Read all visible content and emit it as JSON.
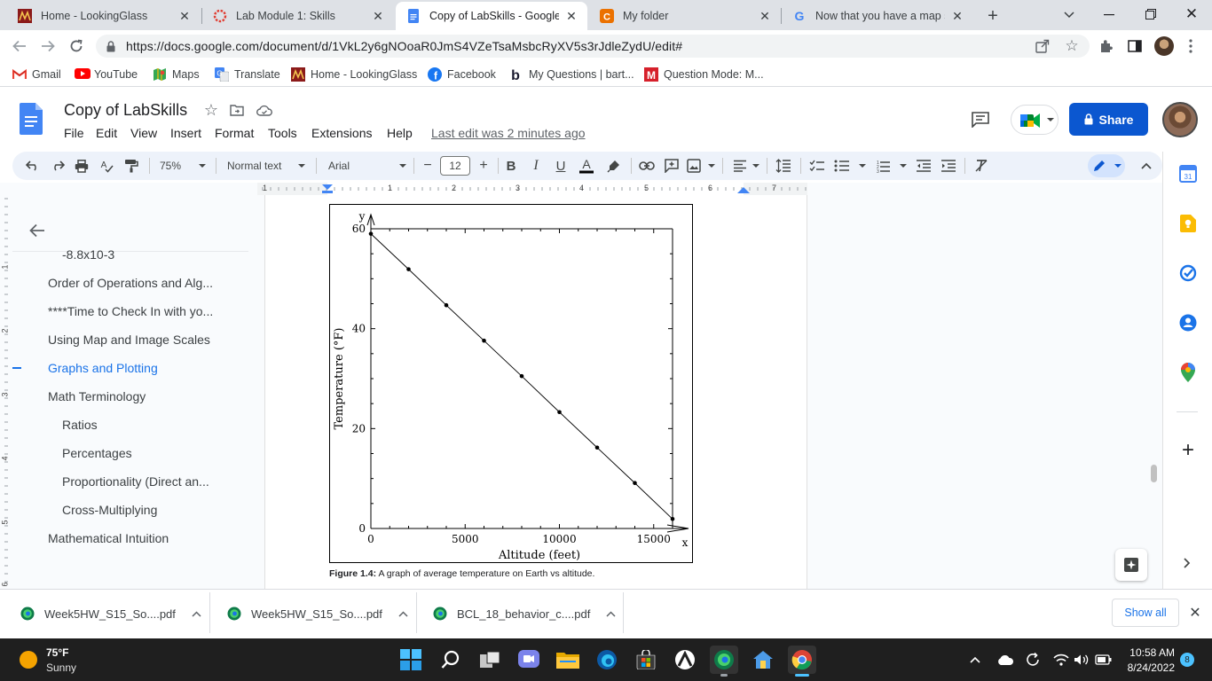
{
  "browser": {
    "tabs": [
      {
        "title": "Home - LookingGlass",
        "icon": "lookingglass-icon",
        "active": false
      },
      {
        "title": "Lab Module 1: Skills",
        "icon": "canvas-icon",
        "active": false
      },
      {
        "title": "Copy of LabSkills - Google Do",
        "icon": "google-docs-icon",
        "active": true
      },
      {
        "title": "My folder",
        "icon": "chegg-icon",
        "active": false
      },
      {
        "title": "Now that you have a map sca",
        "icon": "google-icon",
        "active": false
      }
    ],
    "url": "https://docs.google.com/document/d/1VkL2y6gNOoaR0JmS4VZeTsaMsbcRyXV5s3rJdleZydU/edit#",
    "bookmarks": [
      {
        "label": "Gmail",
        "icon": "gmail-icon"
      },
      {
        "label": "YouTube",
        "icon": "youtube-icon"
      },
      {
        "label": "Maps",
        "icon": "maps-icon"
      },
      {
        "label": "Translate",
        "icon": "translate-icon"
      },
      {
        "label": "Home - LookingGlass",
        "icon": "lookingglass-icon"
      },
      {
        "label": "Facebook",
        "icon": "facebook-icon"
      },
      {
        "label": "My Questions | bart...",
        "icon": "bartleby-icon"
      },
      {
        "label": "Question Mode: M...",
        "icon": "mcgraw-icon"
      }
    ]
  },
  "docs": {
    "title": "Copy of LabSkills",
    "menus": [
      "File",
      "Edit",
      "View",
      "Insert",
      "Format",
      "Tools",
      "Extensions",
      "Help"
    ],
    "last_edit": "Last edit was 2 minutes ago",
    "share_label": "Share",
    "toolbar": {
      "zoom": "75%",
      "style": "Normal text",
      "font": "Arial",
      "font_size": "12"
    },
    "ruler_numbers": [
      "1",
      "1",
      "2",
      "3",
      "4",
      "5",
      "6",
      "7"
    ],
    "vruler_numbers": [
      "1",
      "2",
      "3",
      "4",
      "5",
      "6"
    ]
  },
  "outline": {
    "items": [
      {
        "label": "-8.8x10-3",
        "level": 2,
        "active": false
      },
      {
        "label": "Order of Operations and Alg...",
        "level": 1,
        "active": false
      },
      {
        "label": "****Time to Check In with yo...",
        "level": 1,
        "active": false
      },
      {
        "label": "Using Map and Image Scales",
        "level": 1,
        "active": false
      },
      {
        "label": "Graphs and Plotting",
        "level": 1,
        "active": true
      },
      {
        "label": "Math Terminology",
        "level": 1,
        "active": false
      },
      {
        "label": "Ratios",
        "level": 2,
        "active": false
      },
      {
        "label": "Percentages",
        "level": 2,
        "active": false
      },
      {
        "label": "Proportionality (Direct an...",
        "level": 2,
        "active": false
      },
      {
        "label": "Cross-Multiplying",
        "level": 2,
        "active": false
      },
      {
        "label": "Mathematical Intuition",
        "level": 1,
        "active": false
      }
    ]
  },
  "figure": {
    "caption_bold": "Figure 1.4:",
    "caption_text": " A graph of average temperature on Earth vs altitude."
  },
  "chart_data": {
    "type": "line",
    "title": "",
    "xlabel": "Altitude (feet)",
    "ylabel": "Temperature (°F)",
    "x_axis_letter": "x",
    "y_axis_letter": "y",
    "xlim": [
      0,
      16000
    ],
    "ylim": [
      0,
      60
    ],
    "xticks": [
      0,
      5000,
      10000,
      15000
    ],
    "yticks": [
      0,
      20,
      40,
      60
    ],
    "grid": false,
    "series": [
      {
        "x": [
          0,
          2000,
          4000,
          6000,
          8000,
          10000,
          12000,
          14000,
          16000
        ],
        "y": [
          59,
          51.9,
          44.7,
          37.6,
          30.5,
          23.3,
          16.2,
          9.1,
          1.9
        ]
      }
    ]
  },
  "downloads": [
    {
      "name": "Week5HW_S15_So....pdf"
    },
    {
      "name": "Week5HW_S15_So....pdf"
    },
    {
      "name": "BCL_18_behavior_c....pdf"
    }
  ],
  "downloads_show_all": "Show all",
  "taskbar": {
    "temperature": "75°F",
    "weather": "Sunny",
    "time": "10:58 AM",
    "date": "8/24/2022",
    "notification_count": "8"
  },
  "colors": {
    "accent": "#1a73e8",
    "tab_strip": "#dee1e6",
    "toolbar": "#edf2fa",
    "taskbar": "#1f1f1f"
  }
}
